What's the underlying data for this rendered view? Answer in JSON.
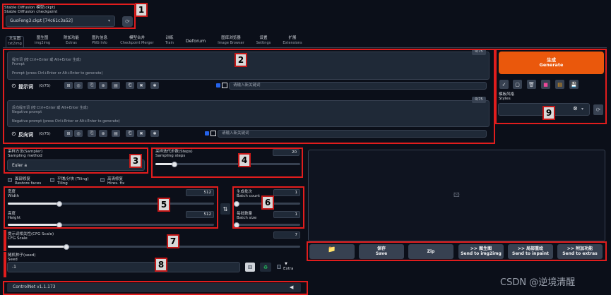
{
  "checkpoint": {
    "label_cn": "Stable Diffusion 模型(ckpt)",
    "label_en": "Stable Diffusion checkpoint",
    "value": "GuoFeng3.ckpt [74c61c3a52]",
    "refresh_icon": "refresh-icon"
  },
  "tabs": [
    {
      "cn": "文生图",
      "en": "txt2img"
    },
    {
      "cn": "图生图",
      "en": "img2img"
    },
    {
      "cn": "附加功能",
      "en": "Extras"
    },
    {
      "cn": "图片信息",
      "en": "PNG Info"
    },
    {
      "cn": "模型合并",
      "en": "Checkpoint Merger"
    },
    {
      "cn": "训练",
      "en": "Train"
    },
    {
      "cn": "Deforum",
      "en": ""
    },
    {
      "cn": "图库浏览器",
      "en": "Image Browser"
    },
    {
      "cn": "设置",
      "en": "Settings"
    },
    {
      "cn": "扩展",
      "en": "Extensions"
    }
  ],
  "prompt": {
    "counter": "0/75",
    "placeholder_cn": "提示词 (按 Ctrl+Enter 或 Alt+Enter 生成)",
    "placeholder_en1": "Prompt",
    "placeholder_en2": "Prompt (press Ctrl+Enter or Alt+Enter to generate)",
    "toolbar_label": "提示词",
    "toolbar_count": "(0/75)",
    "keyword_placeholder": "请输入新关键词"
  },
  "negative": {
    "counter": "0/75",
    "placeholder_cn": "反向提示词 (按 Ctrl+Enter 或 Alt+Enter 生成)",
    "placeholder_en1": "Negative prompt",
    "placeholder_en2": "Negative prompt (press Ctrl+Enter or Alt+Enter to generate)",
    "toolbar_label": "反向词",
    "toolbar_count": "(0/75)",
    "keyword_placeholder": "请输入新关键词"
  },
  "generate": {
    "cn": "生成",
    "en": "Generate"
  },
  "styles": {
    "cn": "模板风格",
    "en": "Styles"
  },
  "sampler": {
    "cn": "采样方法(Sampler)",
    "en": "Sampling method",
    "value": "Euler a"
  },
  "steps": {
    "cn": "采样迭代步数(Steps)",
    "en": "Sampling steps",
    "value": "20",
    "fraction": 0.13
  },
  "options": [
    {
      "cn": "面部修复",
      "en": "Restore faces"
    },
    {
      "cn": "平铺/分块 (Tiling)",
      "en": "Tiling"
    },
    {
      "cn": "高清修复",
      "en": "Hires. fix"
    }
  ],
  "width": {
    "cn": "宽度",
    "en": "Width",
    "value": "512",
    "fraction": 0.25
  },
  "height": {
    "cn": "高度",
    "en": "Height",
    "value": "512",
    "fraction": 0.25
  },
  "batch_count": {
    "cn": "生成批次",
    "en": "Batch count",
    "value": "1",
    "fraction": 0.0
  },
  "batch_size": {
    "cn": "每批数量",
    "en": "Batch size",
    "value": "1",
    "fraction": 0.0
  },
  "cfg": {
    "cn": "提示词相关性(CFG Scale)",
    "en": "CFG Scale",
    "value": "7",
    "fraction": 0.2
  },
  "seed": {
    "cn": "随机种子(seed)",
    "en": "Seed",
    "value": "-1",
    "extra": "Extra"
  },
  "controlnet": {
    "label": "ControlNet v1.1.173",
    "arrow": "◀"
  },
  "actions": [
    {
      "cn": "",
      "en": "",
      "icon": "folder-icon"
    },
    {
      "cn": "保存",
      "en": "Save"
    },
    {
      "cn": "",
      "en": "Zip"
    },
    {
      "cn": ">> 图生图",
      "en": "Send to img2img"
    },
    {
      "cn": ">> 局部重绘",
      "en": "Send to inpaint"
    },
    {
      "cn": ">> 附加功能",
      "en": "Send to extras"
    }
  ],
  "badges": [
    "1",
    "2",
    "3",
    "4",
    "5",
    "6",
    "7",
    "8",
    "9"
  ],
  "watermark": "CSDN @逆境清醒",
  "colors": {
    "generate": "#ea580c",
    "highlight": "#e11d1d",
    "background": "#0b0f19"
  }
}
